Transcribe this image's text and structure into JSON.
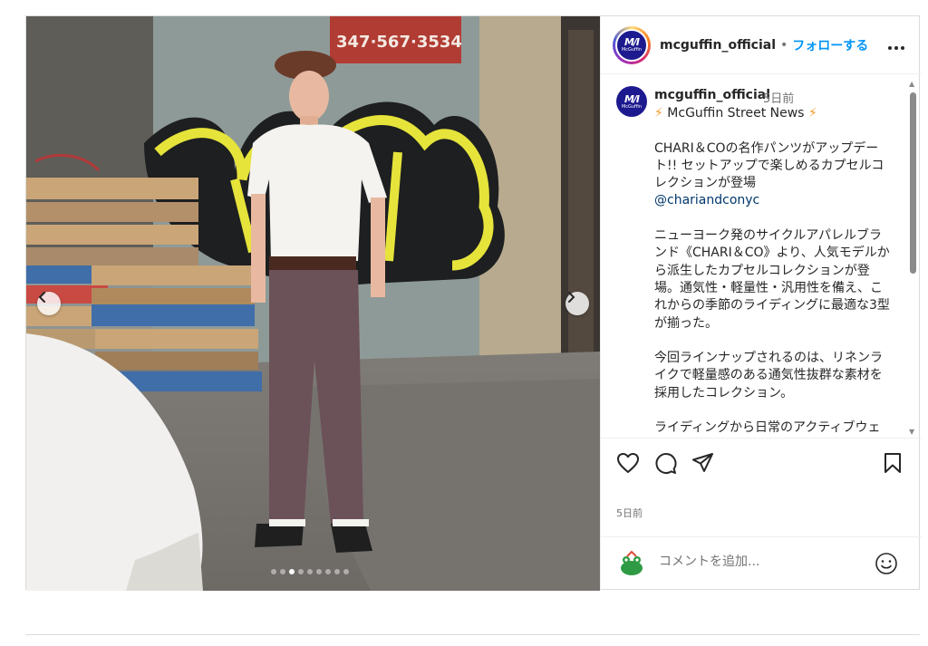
{
  "header": {
    "username": "mcguffin_official",
    "separator": "•",
    "follow_label": "フォローする",
    "more_icon": "more-horizontal-icon"
  },
  "avatar": {
    "mark": "M/I",
    "sub": "McGuffin"
  },
  "media": {
    "sign_text": "347·567·3534",
    "slide_count": 9,
    "active_slide": 3
  },
  "caption": {
    "username": "mcguffin_official",
    "time": "5日前",
    "news_line": "McGuffin Street News",
    "text1": "CHARI＆COの名作パンツがアップデート!! セットアップで楽しめるカプセルコレクションが登場",
    "tag": "@chariandconyc",
    "text2": "ニューヨーク発のサイクルアパレルブランド《CHARI＆CO》より、人気モデルから派生したカプセルコレクションが登場。通気性・軽量性・汎用性を備え、これからの季節のライディングに最適な3型が揃った。",
    "text3": "今回ラインナップされるのは、リネンライクで軽量感のある通気性抜群な素材を採用したコレクション。",
    "text4": "ライディングから日常のアクティブウェアまで、幅広いシーンで活躍するコレクションとなっている。"
  },
  "actions": {
    "like_icon": "heart-icon",
    "comment_icon": "comment-icon",
    "share_icon": "send-icon",
    "save_icon": "bookmark-icon"
  },
  "footer": {
    "time": "5日前",
    "comment_placeholder": "コメントを追加...",
    "emoji_icon": "emoji-icon"
  },
  "colors": {
    "accent": "#0095f6",
    "brand": "#1d1a8f",
    "text": "#262626",
    "muted": "#737373"
  }
}
